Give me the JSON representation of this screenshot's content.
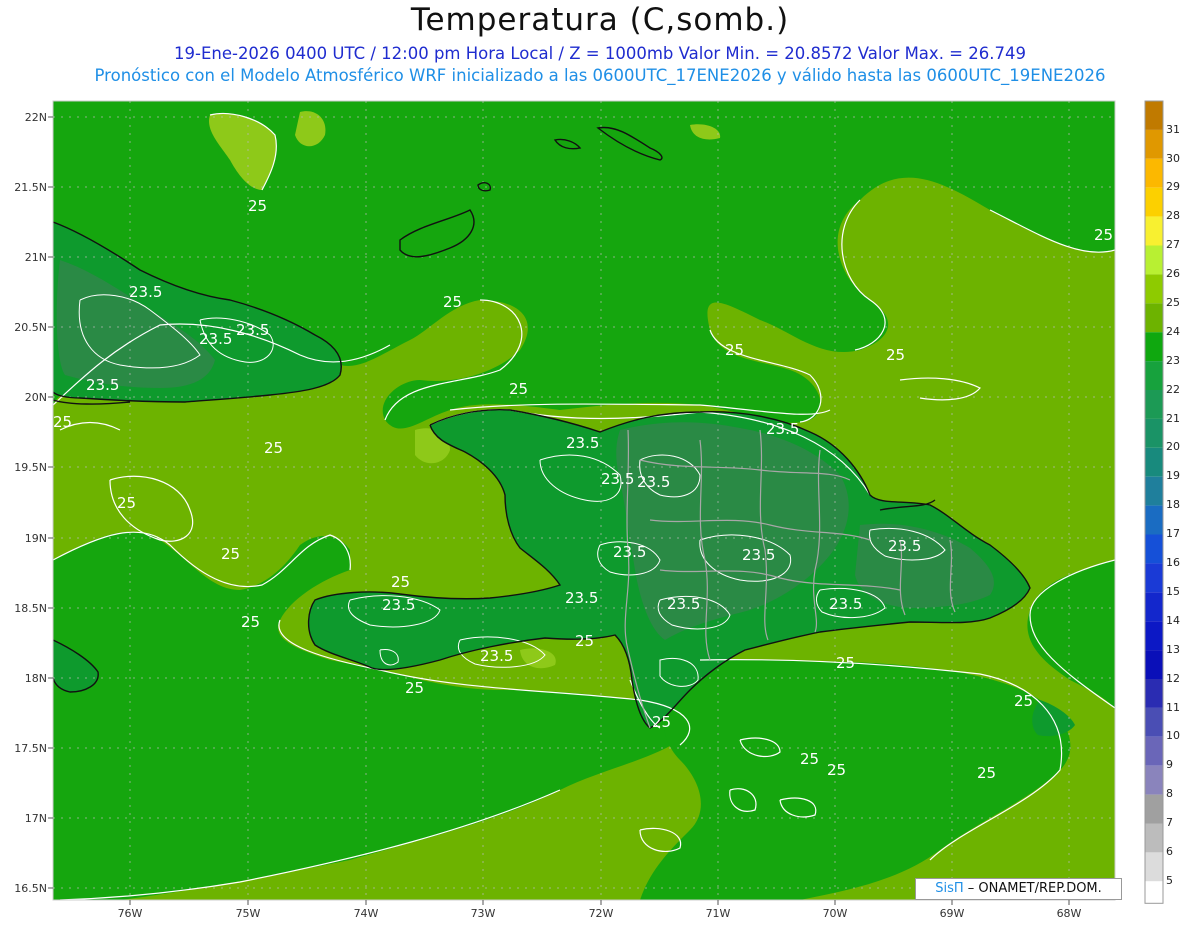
{
  "header": {
    "title": "Temperatura (C,somb.)",
    "subtitle_line1": "19-Ene-2026 0400 UTC / 12:00 pm Hora Local / Z = 1000mb    Valor Min. = 20.8572  Valor Max. = 26.749",
    "subtitle_line2": "Pronóstico con el Modelo Atmosférico WRF inicializado a las 0600UTC_17ENE2026 y válido hasta las  0600UTC_19ENE2026"
  },
  "map": {
    "lat_labels": [
      "22N",
      "21.5N",
      "21N",
      "20.5N",
      "20N",
      "19.5N",
      "19N",
      "18.5N",
      "18N",
      "17.5N",
      "17N",
      "16.5N"
    ],
    "lon_labels": [
      "76W",
      "75W",
      "74W",
      "73W",
      "72W",
      "71W",
      "70W",
      "69W",
      "68W"
    ],
    "contour_labels": [
      "25",
      "25",
      "25",
      "25",
      "25",
      "25",
      "25",
      "25",
      "25",
      "25",
      "25",
      "25",
      "25",
      "25",
      "25",
      "25",
      "25",
      "25",
      "25",
      "25",
      "23.5",
      "23.5",
      "23.5",
      "23.5",
      "23.5",
      "23.5",
      "23.5",
      "23.5",
      "23.5",
      "23.5",
      "23.5",
      "23.5",
      "23.5",
      "23.5",
      "23.5",
      "23.5"
    ],
    "colors": {
      "ocean": "#6db300",
      "warm_sea": "#15a60e",
      "land": "#0e9a2d",
      "interior": "#2a8a45",
      "light": "#8ec919",
      "coast": "#111111",
      "border": "#a7a7a7",
      "contour": "#ffffff"
    }
  },
  "colorbar": {
    "ticks": [
      "31",
      "30",
      "29",
      "28",
      "27",
      "26",
      "25",
      "24",
      "23",
      "22",
      "21",
      "20",
      "19",
      "18",
      "17",
      "16",
      "15",
      "14",
      "13",
      "12",
      "11",
      "10",
      "9",
      "8",
      "7",
      "6",
      "5"
    ],
    "colors": [
      "#c07a00",
      "#e09800",
      "#fcb800",
      "#fcd000",
      "#f8f030",
      "#b8f032",
      "#8ecb00",
      "#6db300",
      "#0fa80f",
      "#17a23d",
      "#1c9a55",
      "#1a9366",
      "#188a7d",
      "#1f7f9c",
      "#1a6cc2",
      "#1550d8",
      "#1a3ad6",
      "#1327cc",
      "#0c18c5",
      "#0a0fb8",
      "#2a2cb2",
      "#4a4eb4",
      "#6a66b8",
      "#8a84bc",
      "#a0a0a0",
      "#bcbcbc",
      "#dcdcdc",
      "#ffffff"
    ]
  },
  "footer": {
    "brand": "SisΠ",
    "credit": "– ONAMET/REP.DOM."
  }
}
